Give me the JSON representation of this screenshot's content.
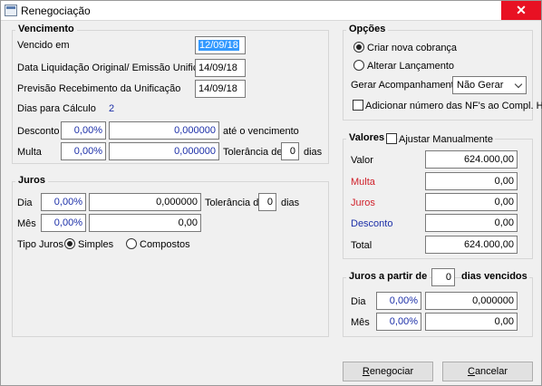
{
  "window": {
    "title": "Renegociação",
    "close_icon": "close-icon"
  },
  "vencimento": {
    "title": "Vencimento",
    "vencido_em_label": "Vencido em",
    "vencido_em_value": "12/09/18",
    "data_liq_label": "Data Liquidação Original/ Emissão Unificação",
    "data_liq_value": "14/09/18",
    "previsao_label": "Previsão Recebimento da Unificação",
    "previsao_value": "14/09/18",
    "dias_calc_label": "Dias para Cálculo",
    "dias_calc_value": "2",
    "desconto_label": "Desconto",
    "desconto_pct": "0,00%",
    "desconto_value": "0,000000",
    "ate_label": "até o vencimento",
    "multa_label": "Multa",
    "multa_pct": "0,00%",
    "multa_value": "0,000000",
    "tolerancia_label": "Tolerância de",
    "tolerancia_value": "0",
    "dias_label": "dias"
  },
  "juros": {
    "title": "Juros",
    "dia_label": "Dia",
    "dia_pct": "0,00%",
    "dia_value": "0,000000",
    "tolerancia_label": "Tolerância de",
    "tolerancia_value": "0",
    "dias_label": "dias",
    "mes_label": "Mês",
    "mes_pct": "0,00%",
    "mes_value": "0,00",
    "tipo_label": "Tipo Juros",
    "simples_label": "Simples",
    "compostos_label": "Compostos",
    "selected": "Simples"
  },
  "opcoes": {
    "title": "Opções",
    "criar_label": "Criar nova cobrança",
    "alterar_label": "Alterar Lançamento",
    "selected": "Criar nova cobrança",
    "gerar_label": "Gerar Acompanhamento",
    "gerar_value": "Não Gerar",
    "adicionar_label": "Adicionar número das NF's ao Compl. Hist.",
    "adicionar_checked": false
  },
  "valores": {
    "title": "Valores",
    "ajustar_label": "Ajustar Manualmente",
    "ajustar_checked": false,
    "valor_label": "Valor",
    "valor_value": "624.000,00",
    "multa_label": "Multa",
    "multa_value": "0,00",
    "juros_label": "Juros",
    "juros_value": "0,00",
    "desconto_label": "Desconto",
    "desconto_value": "0,00",
    "total_label": "Total",
    "total_value": "624.000,00"
  },
  "juros_partir": {
    "title": "Juros a partir de",
    "dias_value": "0",
    "dias_label": "dias vencidos",
    "dia_label": "Dia",
    "dia_pct": "0,00%",
    "dia_value": "0,000000",
    "mes_label": "Mês",
    "mes_pct": "0,00%",
    "mes_value": "0,00"
  },
  "buttons": {
    "renegociar": "Renegociar",
    "cancelar": "Cancelar"
  },
  "colors": {
    "label_red": "#d0202a",
    "label_blue": "#1c2fa8",
    "selection": "#3399ff",
    "close": "#e81123"
  }
}
